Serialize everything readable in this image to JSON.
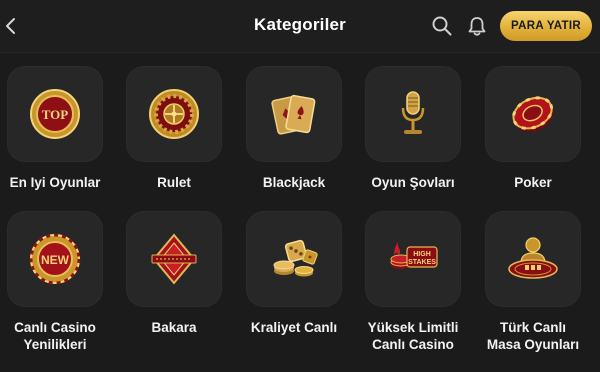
{
  "header": {
    "title": "Kategoriler",
    "deposit_label": "PARA YATIR"
  },
  "colors": {
    "background": "#1b1b1b",
    "tile": "#272727",
    "accent_gold": "#e2b23c",
    "icon_red": "#b3121b"
  },
  "categories": [
    {
      "label": "En Iyi Oyunlar",
      "icon": "top-badge-icon",
      "badge_text": "TOP"
    },
    {
      "label": "Rulet",
      "icon": "roulette-wheel-icon"
    },
    {
      "label": "Blackjack",
      "icon": "playing-cards-icon"
    },
    {
      "label": "Oyun Şovları",
      "icon": "microphone-icon"
    },
    {
      "label": "Poker",
      "icon": "poker-chip-icon"
    },
    {
      "label": "Canlı Casino\nYenilikleri",
      "icon": "new-badge-icon",
      "badge_text": "NEW"
    },
    {
      "label": "Bakara",
      "icon": "baccarat-diamond-icon"
    },
    {
      "label": "Kraliyet Canlı",
      "icon": "dice-coins-icon"
    },
    {
      "label": "Yüksek Limitli\nCanlı Casino",
      "icon": "high-stakes-icon",
      "badge_text": "HIGH\nSTAKES"
    },
    {
      "label": "Türk Canlı\nMasa Oyunları",
      "icon": "dealer-table-icon"
    }
  ]
}
